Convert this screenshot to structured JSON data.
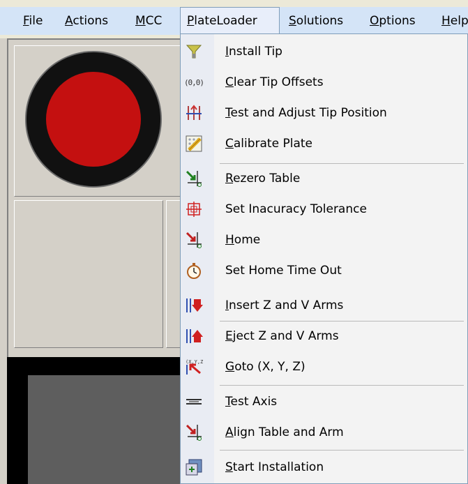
{
  "menubar": {
    "items": [
      {
        "label": "File",
        "accel": "F"
      },
      {
        "label": "Actions",
        "accel": "A"
      },
      {
        "label": "MCC",
        "accel": "M"
      },
      {
        "label": "PlateLoader",
        "accel": "P"
      },
      {
        "label": "Solutions",
        "accel": "S"
      },
      {
        "label": "Options",
        "accel": "O"
      },
      {
        "label": "Help",
        "accel": "H"
      }
    ]
  },
  "status_lamp": {
    "color": "#c41010"
  },
  "plateloader_menu": {
    "items": [
      {
        "label": "Install Tip",
        "icon": "funnel-icon"
      },
      {
        "label": "Clear Tip Offsets",
        "icon": "offsets-icon",
        "glyph": "(0,0)"
      },
      {
        "label": "Test and Adjust Tip Position",
        "icon": "adjust-tip-icon"
      },
      {
        "label": "Calibrate Plate",
        "icon": "calibrate-icon"
      },
      {
        "label": "Rezero Table",
        "icon": "rezero-arrow-icon"
      },
      {
        "label": "Set Inacuracy Tolerance",
        "icon": "crosshair-icon"
      },
      {
        "label": "Home",
        "icon": "home-arrow-icon"
      },
      {
        "label": "Set Home Time Out",
        "icon": "stopwatch-icon"
      },
      {
        "label": "Insert Z and V Arms",
        "icon": "insert-arms-icon"
      },
      {
        "label": "Eject Z and V Arms",
        "icon": "eject-arms-icon"
      },
      {
        "label": "Goto (X, Y, Z)",
        "icon": "goto-xyz-icon",
        "glyph": "(X,Y,Z)"
      },
      {
        "label": "Test Axis",
        "icon": "test-axis-icon"
      },
      {
        "label": "Align Table and Arm",
        "icon": "align-arrow-icon"
      },
      {
        "label": "Start Installation",
        "icon": "installation-icon"
      }
    ]
  }
}
